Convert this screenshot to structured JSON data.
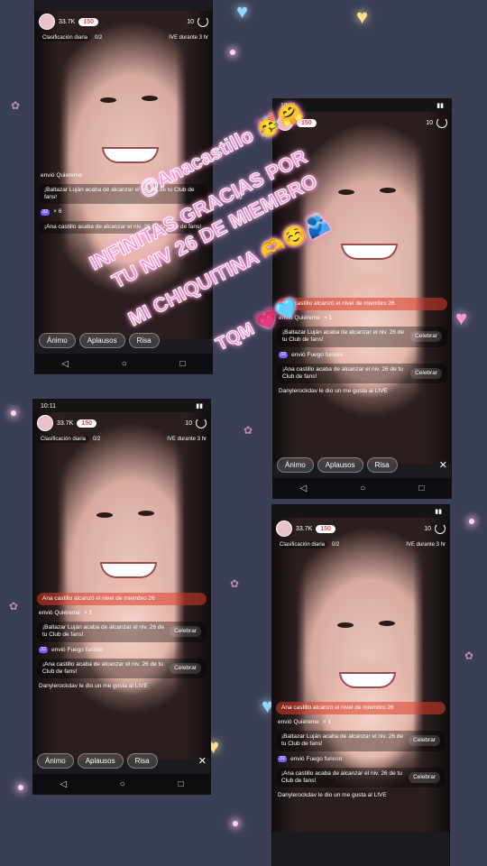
{
  "overlay": {
    "handle": "@Anacastillo 🥳🤗",
    "line1": "INFINITAS GRACIAS POR",
    "line2": "TU NIV 26 DE MIEMBRO",
    "line3": "MI CHIQUITINA 🫶☺️🫂",
    "line4": "TQM 💗🩵"
  },
  "status": {
    "time": "10:11"
  },
  "header": {
    "likes": "150",
    "viewers": "10",
    "followers": "33.7K",
    "ranking": "Clasificación diaria",
    "gift_count": "0/2",
    "live_label": "IVE durante 3 hr"
  },
  "chat": {
    "level_up": "Ana castillo alcanzó el nivel de miembro 26",
    "sent_quiereme": "envió Quiéreme",
    "sent_quiereme_count": "× 1",
    "baltazar_msg": "¡Baltazar Luján acaba de alcanzar el niv. 26 de tu Club de fans!",
    "ana_msg": "¡Ana castillo acaba de alcanzar el niv. 26 de tu Club de fans!",
    "celebrate": "Celebrar",
    "badge_level": "32",
    "fire_gift": "envió Fuego furioso",
    "fire_count": "× 6",
    "like_msg": "Danylerockdav le dio un me gusta al LIVE"
  },
  "actions": {
    "animo": "Ánimo",
    "aplausos": "Aplausos",
    "risa": "Risa"
  }
}
